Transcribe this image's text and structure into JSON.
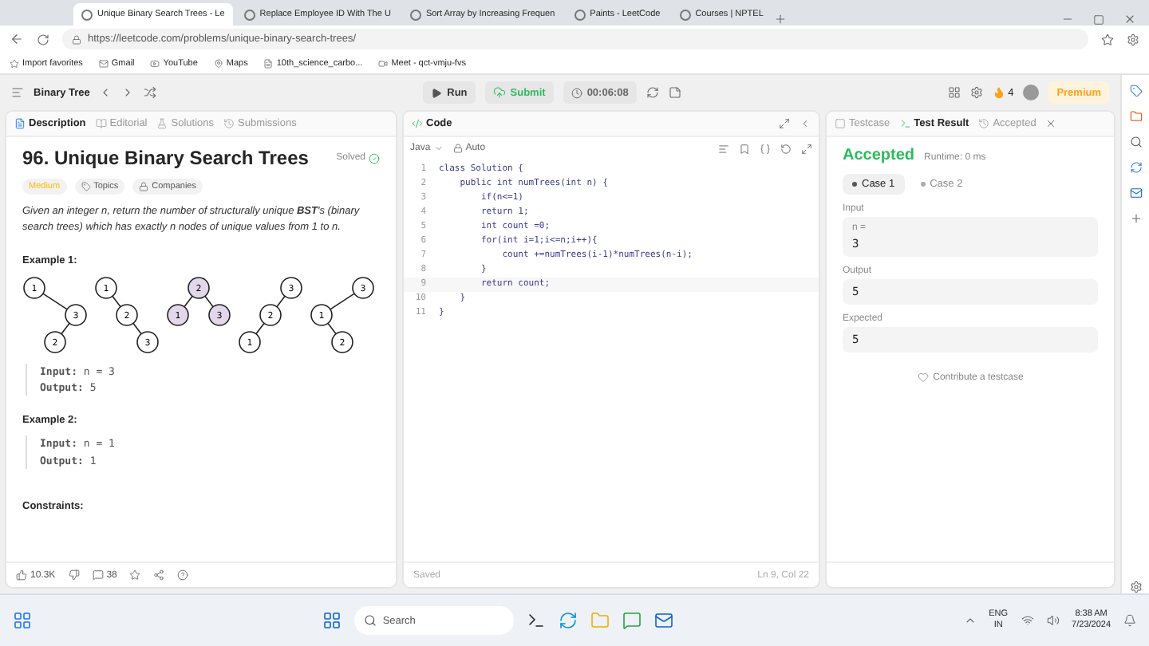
{
  "browser": {
    "tabs": [
      {
        "title": "Unique Binary Search Trees - Le",
        "selected": true
      },
      {
        "title": "Replace Employee ID With The U",
        "selected": false
      },
      {
        "title": "Sort Array by Increasing Frequen",
        "selected": false
      },
      {
        "title": "Paints - LeetCode",
        "selected": false
      },
      {
        "title": "Courses | NPTEL",
        "selected": false
      }
    ],
    "address": "https://leetcode.com/problems/unique-binary-search-trees/",
    "favorites": [
      "Import favorites",
      "Gmail",
      "YouTube",
      "Maps",
      "10th_science_carbo...",
      "Meet - qct-vmju-fvs"
    ]
  },
  "toolbar": {
    "problem_list": "Binary Tree",
    "run": "Run",
    "submit": "Submit",
    "timer": "00:06:08",
    "streak": "4",
    "premium": "Premium"
  },
  "description": {
    "tabs": [
      {
        "label": "Description",
        "selected": true
      },
      {
        "label": "Editorial",
        "selected": false
      },
      {
        "label": "Solutions",
        "selected": false
      },
      {
        "label": "Submissions",
        "selected": false
      }
    ],
    "title": "96. Unique Binary Search Trees",
    "status": "Solved",
    "tags": [
      "Medium",
      "Topics",
      "Companies"
    ],
    "statement": "Given an integer n, return the number of structurally unique **BST**'s (binary search trees) which has exactly n nodes of unique values from 1 to n.",
    "examples": [
      {
        "heading": "Example 1:",
        "trees": [
          {
            "highlighted": false,
            "root": {
              "value": "1",
              "right": {
                "value": "3",
                "left": {
                  "value": "2"
                }
              }
            }
          },
          {
            "highlighted": false,
            "root": {
              "value": "1",
              "right": {
                "value": "2",
                "right": {
                  "value": "3"
                }
              }
            }
          },
          {
            "highlighted": true,
            "root": {
              "value": "2",
              "left": {
                "value": "1"
              },
              "right": {
                "value": "3"
              }
            }
          },
          {
            "highlighted": false,
            "root": {
              "value": "3",
              "left": {
                "value": "2",
                "left": {
                  "value": "1"
                }
              }
            }
          },
          {
            "highlighted": false,
            "root": {
              "value": "3",
              "left": {
                "value": "1",
                "right": {
                  "value": "2"
                }
              }
            }
          }
        ],
        "input": "**Input:** n = 3",
        "output": "**Output:** 5"
      },
      {
        "heading": "Example 2:",
        "input": "**Input:** n = 1",
        "output": "**Output:** 1"
      }
    ],
    "constraints_heading": "Constraints:",
    "likes": "10.3K",
    "comments": "38"
  },
  "code": {
    "title": "Code",
    "language": "Java",
    "mode": "Auto",
    "lines": [
      {
        "number": "1",
        "text": "class Solution {"
      },
      {
        "number": "2",
        "text": "    public int numTrees(int n) {"
      },
      {
        "number": "3",
        "text": "        if(n<=1)"
      },
      {
        "number": "4",
        "text": "        return 1;"
      },
      {
        "number": "5",
        "text": "        int count =0;"
      },
      {
        "number": "6",
        "text": "        for(int i=1;i<=n;i++){"
      },
      {
        "number": "7",
        "text": "            count +=numTrees(i-1)*numTrees(n-i);"
      },
      {
        "number": "8",
        "text": "        }"
      },
      {
        "number": "9",
        "text": "        return count;"
      },
      {
        "number": "10",
        "text": "    }"
      },
      {
        "number": "11",
        "text": "}"
      }
    ],
    "saved": "Saved",
    "cursor": "Ln 9, Col 22"
  },
  "result": {
    "tabs": [
      {
        "label": "Testcase",
        "selected": false
      },
      {
        "label": "Test Result",
        "selected": true
      },
      {
        "label": "Accepted",
        "selected": false
      }
    ],
    "verdict": "Accepted",
    "runtime": "Runtime: 0 ms",
    "cases": [
      {
        "label": "Case 1",
        "selected": true
      },
      {
        "label": "Case 2",
        "selected": false
      }
    ],
    "fields": [
      {
        "label": "Input",
        "name": "n =",
        "value": "3"
      },
      {
        "label": "Output",
        "value": "5"
      },
      {
        "label": "Expected",
        "value": "5"
      }
    ],
    "contribute": "Contribute a testcase"
  },
  "taskbar": {
    "search": "Search",
    "language": "ENG",
    "region": "IN",
    "time": "8:38 AM",
    "date": "7/23/2024"
  }
}
